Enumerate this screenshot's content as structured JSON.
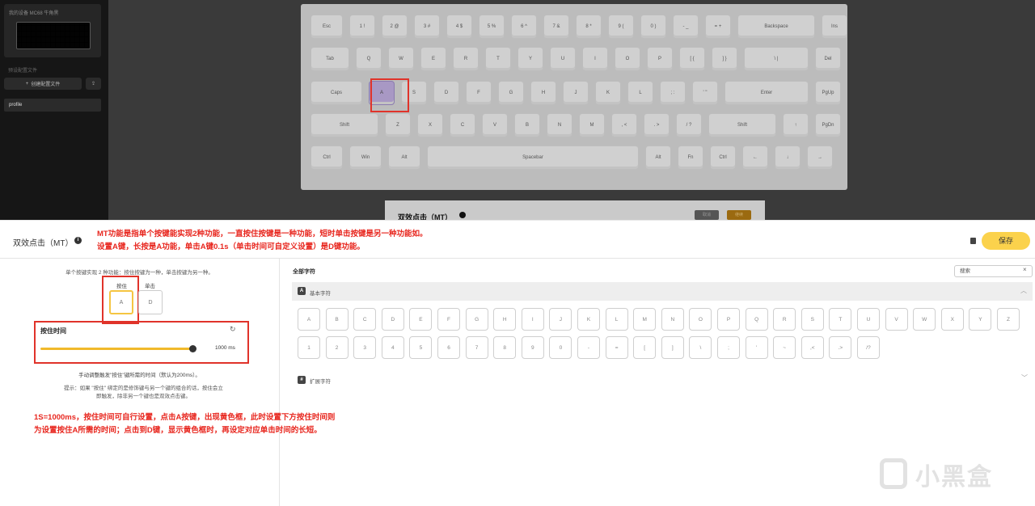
{
  "sidebar": {
    "device_label": "我的设备 MC68 牛角黑",
    "profiles_label": "预设配置文件",
    "create_btn": "创建配置文件",
    "profile_item": "profile"
  },
  "keyboard": {
    "rows": [
      [
        "Esc",
        "1 !",
        "2 @",
        "3 #",
        "4 $",
        "5 %",
        "6 ^",
        "7 &",
        "8 *",
        "9 (",
        "0 )",
        "- _",
        "= +",
        "Backspace",
        "Ins"
      ],
      [
        "Tab",
        "Q",
        "W",
        "E",
        "R",
        "T",
        "Y",
        "U",
        "I",
        "O",
        "P",
        "[ {",
        "] }",
        "\\ |",
        "Del"
      ],
      [
        "Caps",
        "A",
        "S",
        "D",
        "F",
        "G",
        "H",
        "J",
        "K",
        "L",
        "; :",
        "' \"",
        "Enter",
        "PgUp"
      ],
      [
        "Shift",
        "Z",
        "X",
        "C",
        "V",
        "B",
        "N",
        "M",
        ", <",
        ". >",
        "/ ?",
        "Shift",
        "↑",
        "PgDn"
      ],
      [
        "Ctrl",
        "Win",
        "Alt",
        "Spacebar",
        "Alt",
        "Fn",
        "Ctrl",
        "←",
        "↓",
        "→"
      ]
    ],
    "selected_key": "A"
  },
  "modal_strip": {
    "title": "双效点击（MT）",
    "cancel": "取消",
    "next": "继续"
  },
  "panel": {
    "title": "双效点击（MT）",
    "save": "保存",
    "annotations": {
      "top1": "MT功能是指单个按键能实现2种功能，一直按住按键是一种功能，短时单击按键是另一种功能如。",
      "top2": "设置A键，长按是A功能，单击A键0.1s（单击时间可自定义设置）是D键功能。",
      "bottom1": "1S=1000ms，按住时间可自行设置，点击A按键，出现黄色框，此时设置下方按住时间则",
      "bottom2": "为设置按住A所需的时间；点击到D键，显示黄色框时，再设定对应单击时间的长短。"
    },
    "left": {
      "description": "单个按键实现 2 种功能：按住按键为一种，单击按键为另一种。",
      "hold_label": "按住",
      "tap_label": "单击",
      "hold_key": "A",
      "tap_key": "D",
      "hold_time_title": "按住时间",
      "hold_time_value": "1000 ms",
      "hold_time_fraction": 1.0,
      "hint1": "手动调整触发\"按住\"键所需的时间（默认为200ms）。",
      "hint2_line1": "提示：如果 \"按住\" 绑定的是修饰键与另一个键的组合的话，按住会立",
      "hint2_line2": "即触发，除非另一个键也是双效点击键。"
    },
    "right": {
      "all_chars": "全部字符",
      "search_placeholder": "搜索",
      "basic_label": "基本字符",
      "basic_icon": "A",
      "ext_label": "扩展字符",
      "letters": [
        "A",
        "B",
        "C",
        "D",
        "E",
        "F",
        "G",
        "H",
        "I",
        "J",
        "K",
        "L",
        "M",
        "N",
        "O",
        "P",
        "Q",
        "R",
        "S",
        "T",
        "U",
        "V",
        "W",
        "X",
        "Y",
        "Z"
      ],
      "symbols": [
        "1",
        "2",
        "3",
        "4",
        "5",
        "6",
        "7",
        "8",
        "9",
        "0",
        "-",
        "=",
        "[",
        "]",
        "\\",
        ";",
        "'",
        "~",
        ",<",
        ".>",
        "/?"
      ]
    },
    "watermark": "小黑盒"
  }
}
